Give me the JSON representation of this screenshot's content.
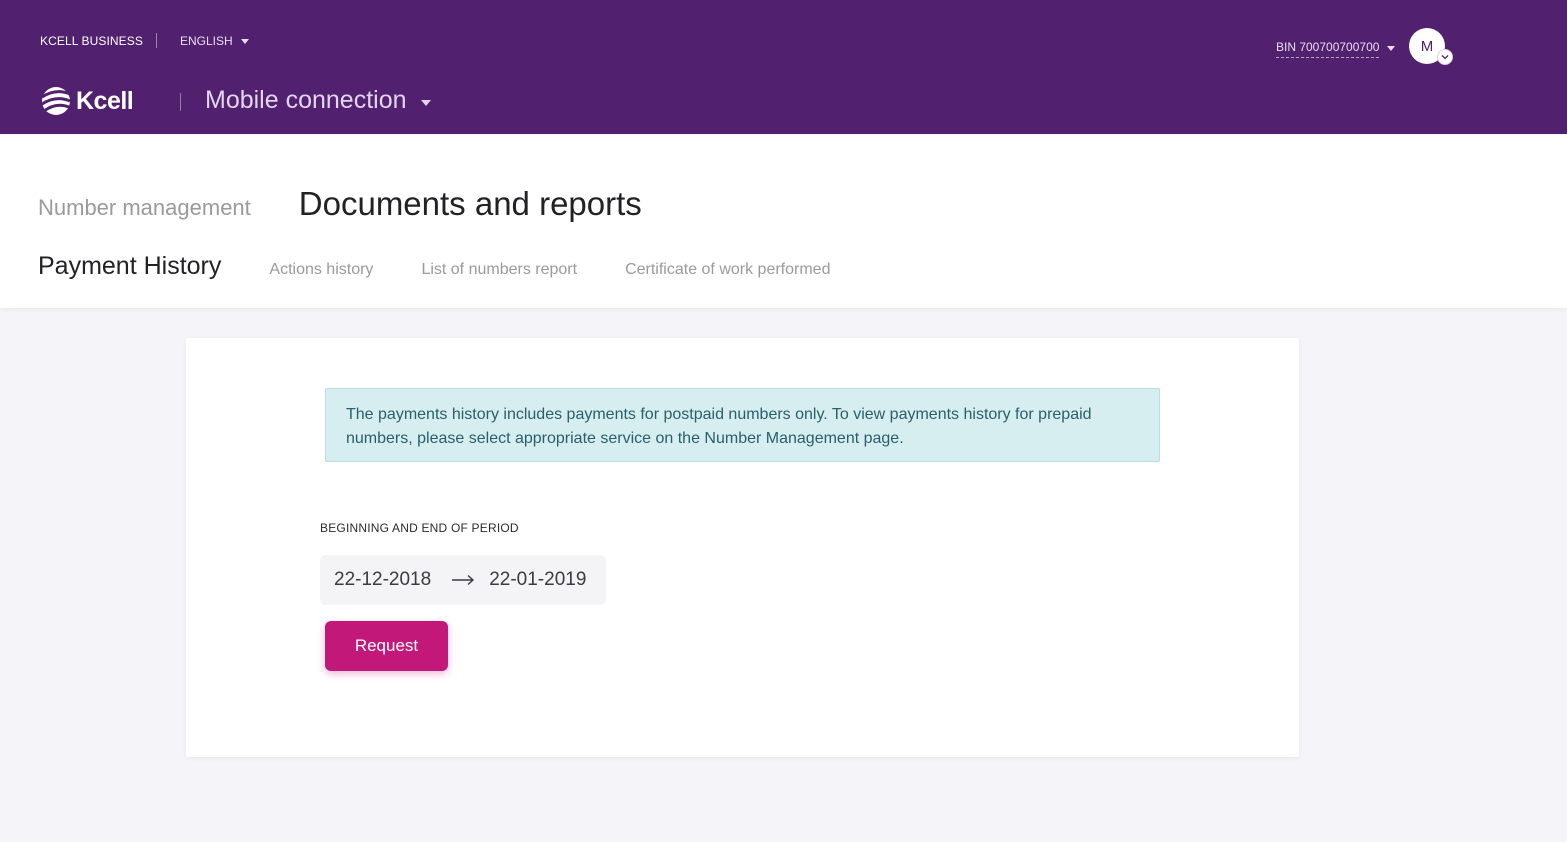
{
  "header": {
    "brand": "KCELL BUSINESS",
    "language": "ENGLISH",
    "logo_text": "Kcell",
    "service": "Mobile connection",
    "bin": "BIN 700700700700",
    "avatar_initial": "M"
  },
  "nav": {
    "primary_tabs": [
      {
        "label": "Number management",
        "active": false
      },
      {
        "label": "Documents and reports",
        "active": true
      }
    ],
    "secondary_tabs": [
      {
        "label": "Payment History",
        "active": true
      },
      {
        "label": "Actions history",
        "active": false
      },
      {
        "label": "List of numbers report",
        "active": false
      },
      {
        "label": "Certificate of work performed",
        "active": false
      }
    ]
  },
  "main": {
    "notice": "The payments history includes payments for postpaid numbers only. To view payments history for prepaid numbers, please select appropriate service on the Number Management page.",
    "period_label": "BEGINNING AND END OF PERIOD",
    "start_date": "22-12-2018",
    "end_date": "22-01-2019",
    "request_label": "Request"
  },
  "colors": {
    "header_bg": "#51206f",
    "accent": "#c2187a",
    "notice_bg": "#d6eef0",
    "notice_text": "#2a5f6b",
    "page_bg": "#f5f4f8"
  },
  "icons": {
    "language_caret": "caret-down-icon",
    "service_caret": "caret-down-icon",
    "bin_caret": "caret-down-icon",
    "avatar_badge": "chevron-down-icon",
    "range_arrow": "arrow-right-icon",
    "logo": "kcell-logo"
  }
}
